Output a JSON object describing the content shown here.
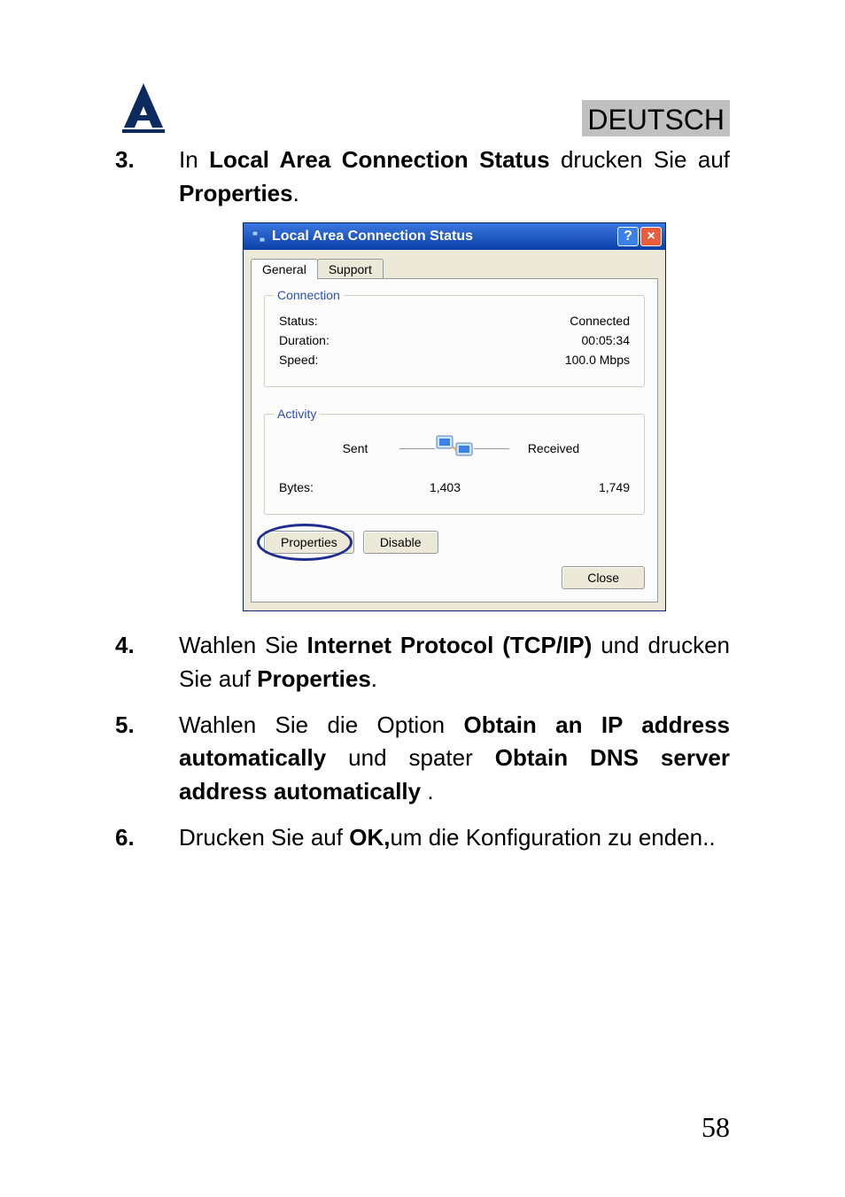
{
  "header": {
    "language_label": "DEUTSCH"
  },
  "steps": {
    "s3": {
      "num": "3.",
      "pre": "In ",
      "bold1": "Local Area Connection Status",
      "mid": " drucken Sie auf ",
      "bold2": "Properties",
      "post": "."
    },
    "s4": {
      "num": "4.",
      "pre": "Wahlen Sie ",
      "bold1": "Internet Protocol (TCP/IP)",
      "mid": " und drucken Sie auf  ",
      "bold2": "Properties",
      "post": "."
    },
    "s5": {
      "num": "5.",
      "pre": "Wahlen Sie die Option  ",
      "bold1": "Obtain an IP address automatically",
      "mid": " und spater ",
      "bold2": "Obtain DNS server address automatically",
      "post": " ."
    },
    "s6": {
      "num": "6.",
      "pre": "Drucken Sie auf ",
      "bold1": "OK,",
      "post": "um die Konfiguration zu enden.."
    }
  },
  "dialog": {
    "title": "Local Area Connection Status",
    "tabs": {
      "general": "General",
      "support": "Support"
    },
    "connection": {
      "legend": "Connection",
      "status_label": "Status:",
      "status_value": "Connected",
      "duration_label": "Duration:",
      "duration_value": "00:05:34",
      "speed_label": "Speed:",
      "speed_value": "100.0 Mbps"
    },
    "activity": {
      "legend": "Activity",
      "sent_label": "Sent",
      "received_label": "Received",
      "bytes_label": "Bytes:",
      "sent_value": "1,403",
      "received_value": "1,749"
    },
    "buttons": {
      "properties": "Properties",
      "disable": "Disable",
      "close": "Close"
    }
  },
  "page_number": "58"
}
